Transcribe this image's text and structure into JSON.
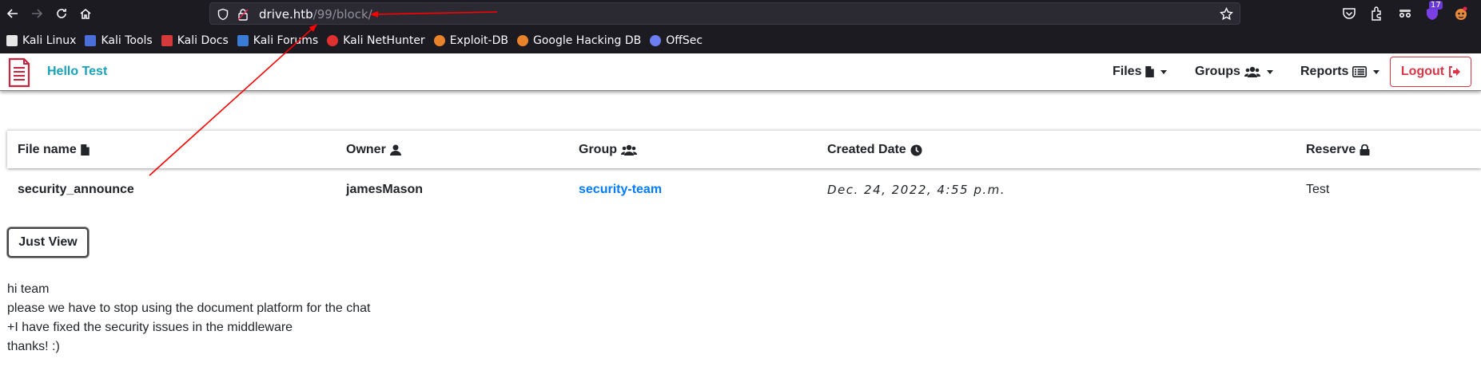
{
  "browser": {
    "url_host": "drive.htb",
    "url_path": "/99/block/",
    "extensions_badge": "17",
    "bookmarks": [
      {
        "label": "Kali Linux",
        "color": "#367bf0"
      },
      {
        "label": "Kali Tools",
        "color": "#4a6fd8"
      },
      {
        "label": "Kali Docs",
        "color": "#d43a3a"
      },
      {
        "label": "Kali Forums",
        "color": "#3a7bd5"
      },
      {
        "label": "Kali NetHunter",
        "color": "#e03030"
      },
      {
        "label": "Exploit-DB",
        "color": "#e8832a"
      },
      {
        "label": "Google Hacking DB",
        "color": "#e8832a"
      },
      {
        "label": "OffSec",
        "color": "#6d7df2"
      }
    ]
  },
  "navbar": {
    "brand": "Hello Test",
    "menu": {
      "files": "Files",
      "groups": "Groups",
      "reports": "Reports",
      "logout": "Logout"
    }
  },
  "table": {
    "headers": {
      "file_name": "File name",
      "owner": "Owner",
      "group": "Group",
      "created_date": "Created Date",
      "reserve": "Reserve"
    },
    "row": {
      "file_name": "security_announce",
      "owner": "jamesMason",
      "group": "security-team",
      "created_date": "Dec. 24, 2022, 4:55 p.m.",
      "reserve": "Test"
    }
  },
  "actions": {
    "just_view": "Just View"
  },
  "message": {
    "lines": [
      "hi team",
      "please we have to stop using the document platform for the chat",
      "+I have fixed the security issues in the middleware",
      "thanks! :)"
    ]
  },
  "colors": {
    "brand": "#17a2b8",
    "logout": "#dc3545",
    "link": "#007bff",
    "annotation": "#ff0000"
  }
}
